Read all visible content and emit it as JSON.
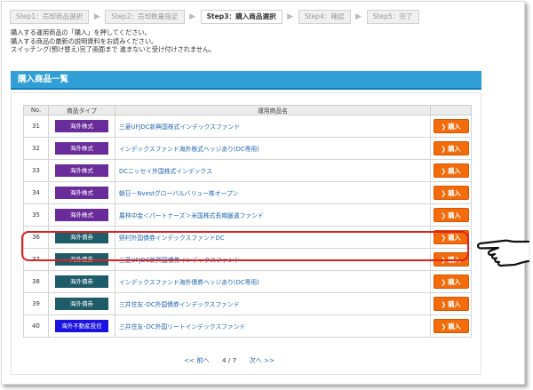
{
  "steps": [
    {
      "label": "Step1：売却商品選択",
      "active": false
    },
    {
      "label": "Step2：売却数量指定",
      "active": false
    },
    {
      "label": "Step3：購入商品選択",
      "active": true
    },
    {
      "label": "Step4：確認",
      "active": false
    },
    {
      "label": "Step5：完了",
      "active": false
    }
  ],
  "instructions": [
    "購入する運用商品の「購入」を押してください。",
    "購入する商品の最新の説明資料をお読みください。",
    "スイッチング(預け替え)完了画面まで 進まないと受け付けされません。"
  ],
  "section_title": "購入商品一覧",
  "table": {
    "headers": {
      "no": "No.",
      "type": "商品タイプ",
      "name": "運用商品名",
      "action": ""
    },
    "buy_label": "購入",
    "rows": [
      {
        "no": "31",
        "type": "海外株式",
        "type_color": "#6a2c9a",
        "name": "三菱UFJDC新興国株式インデックスファンド"
      },
      {
        "no": "32",
        "type": "海外株式",
        "type_color": "#6a2c9a",
        "name": "インデックスファンド海外株式ヘッジあり(DC専用)"
      },
      {
        "no": "33",
        "type": "海外株式",
        "type_color": "#6a2c9a",
        "name": "DCニッセイ外国株式インデックス"
      },
      {
        "no": "34",
        "type": "海外株式",
        "type_color": "#6a2c9a",
        "name": "朝日－Nvestグローバルバリュー株オープン"
      },
      {
        "no": "35",
        "type": "海外株式",
        "type_color": "#6a2c9a",
        "name": "農林中金＜パートナーズ＞米国株式長期厳選ファンド"
      },
      {
        "no": "36",
        "type": "海外債券",
        "type_color": "#1f5c6a",
        "name": "野村外国債券インデックスファンドDC"
      },
      {
        "no": "37",
        "type": "海外債券",
        "type_color": "#1f5c6a",
        "name": "三菱UFJDC新興国債券インデックスファンド"
      },
      {
        "no": "38",
        "type": "海外債券",
        "type_color": "#1f5c6a",
        "name": "インデックスファンド海外債券ヘッジあり(DC専用)"
      },
      {
        "no": "39",
        "type": "海外債券",
        "type_color": "#1f5c6a",
        "name": "三井住友･DC外国債券インデックスファンド"
      },
      {
        "no": "40",
        "type": "海外不動産投信",
        "type_color": "#1a12e0",
        "name": "三井住友･DC外国リートインデックスファンド"
      }
    ]
  },
  "pager": {
    "prev": "<< 前へ",
    "page": "4 / 7",
    "next": "次へ >>"
  },
  "colors": {
    "accent": "#2f9fd6",
    "buy": "#f26c0c",
    "highlight": "#e02020"
  }
}
